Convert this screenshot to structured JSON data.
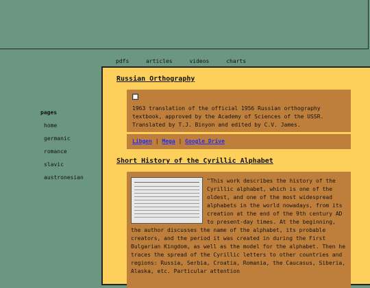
{
  "topnav": [
    "pdfs",
    "articles",
    "videos",
    "charts"
  ],
  "sidebar": {
    "title": "pages",
    "items": [
      "home",
      "germanic",
      "romance",
      "slavic",
      "austronesian"
    ]
  },
  "section1": {
    "title": "Russian Orthography",
    "description": "1963 translation of the official 1956 Russian orthography textbook, approved by the Academy of Sciences of the USSR. Translated by T.J. Binyon and edited by C.V. James.",
    "links": [
      "Libgen",
      "Mega",
      "Google Drive"
    ],
    "separator": "|"
  },
  "section2": {
    "title": "Short History of the Cyrillic Alphabet",
    "description": "\"This work describes the history of the Cyrillic alphabet, which is one of the oldest, and one of the most widespread alphabets in the world nowadays, from its creation at the end of the 9th century AD to present-day times. At the beginning, the author discusses the name of the alphabet, its probable creators, and the period it was created in during the First Bulgarian Kingdom, as well as the model for the alphabet. Then he traces the spread of the Cyrillic letters to other countries and regions: Russia, Serbia, Croatia, Romania, the Caucasus, Siberia, Alaska, etc. Particular attention"
  }
}
